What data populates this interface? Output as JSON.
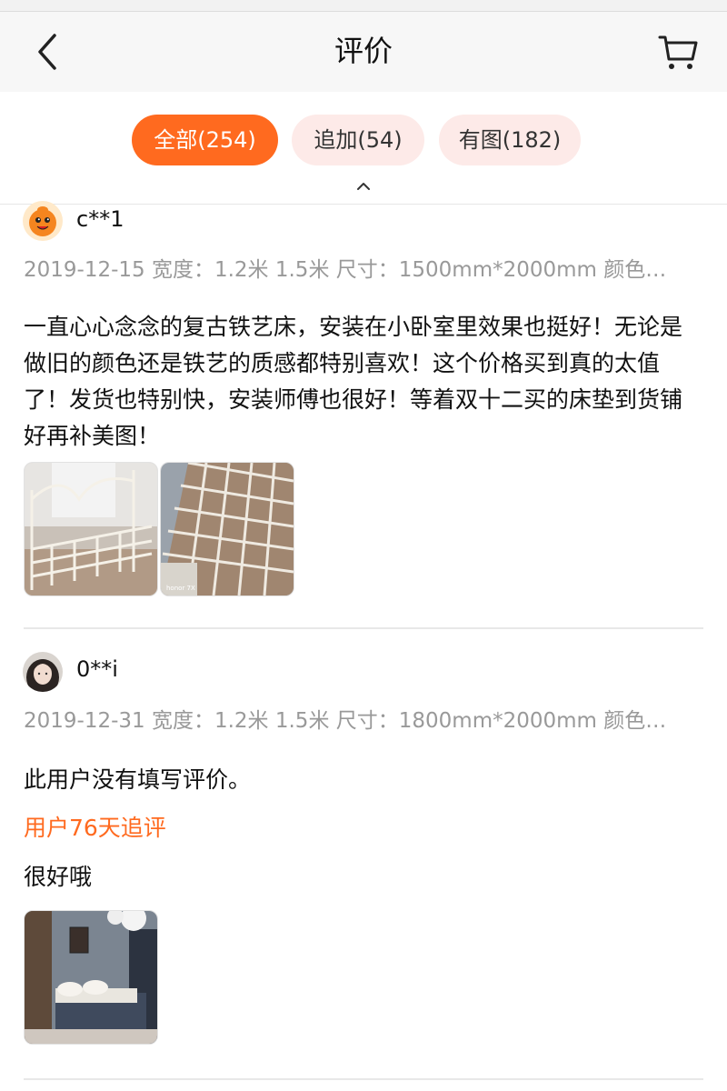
{
  "nav": {
    "title": "评价",
    "back_icon": "chevron-left-icon",
    "cart_icon": "cart-icon"
  },
  "filters": {
    "tabs": [
      {
        "label": "全部(254)",
        "active": true
      },
      {
        "label": "追加(54)",
        "active": false
      },
      {
        "label": "有图(182)",
        "active": false
      }
    ],
    "collapse_icon": "chevron-up-icon"
  },
  "reviews": [
    {
      "username": "c**1",
      "meta": "2019-12-15 宽度：1.2米 1.5米 尺寸：1500mm*2000mm 颜色…",
      "content": "一直心心念念的复古铁艺床，安装在小卧室里效果也挺好！无论是做旧的颜色还是铁艺的质感都特别喜欢！这个价格买到真的太值了！发货也特别快，安装师傅也很好！等着双十二买的床垫到货铺好再补美图！",
      "photo_watermark": "honor 7X"
    },
    {
      "username": "0**i",
      "meta": "2019-12-31 宽度：1.2米 1.5米 尺寸：1800mm*2000mm 颜色…",
      "content": "此用户没有填写评价。",
      "followup_label": "用户76天追评",
      "followup_content": "很好哦"
    }
  ],
  "colors": {
    "accent": "#ff6a1f",
    "chip_inactive_bg": "#fdeae8",
    "meta_text": "#999999"
  }
}
